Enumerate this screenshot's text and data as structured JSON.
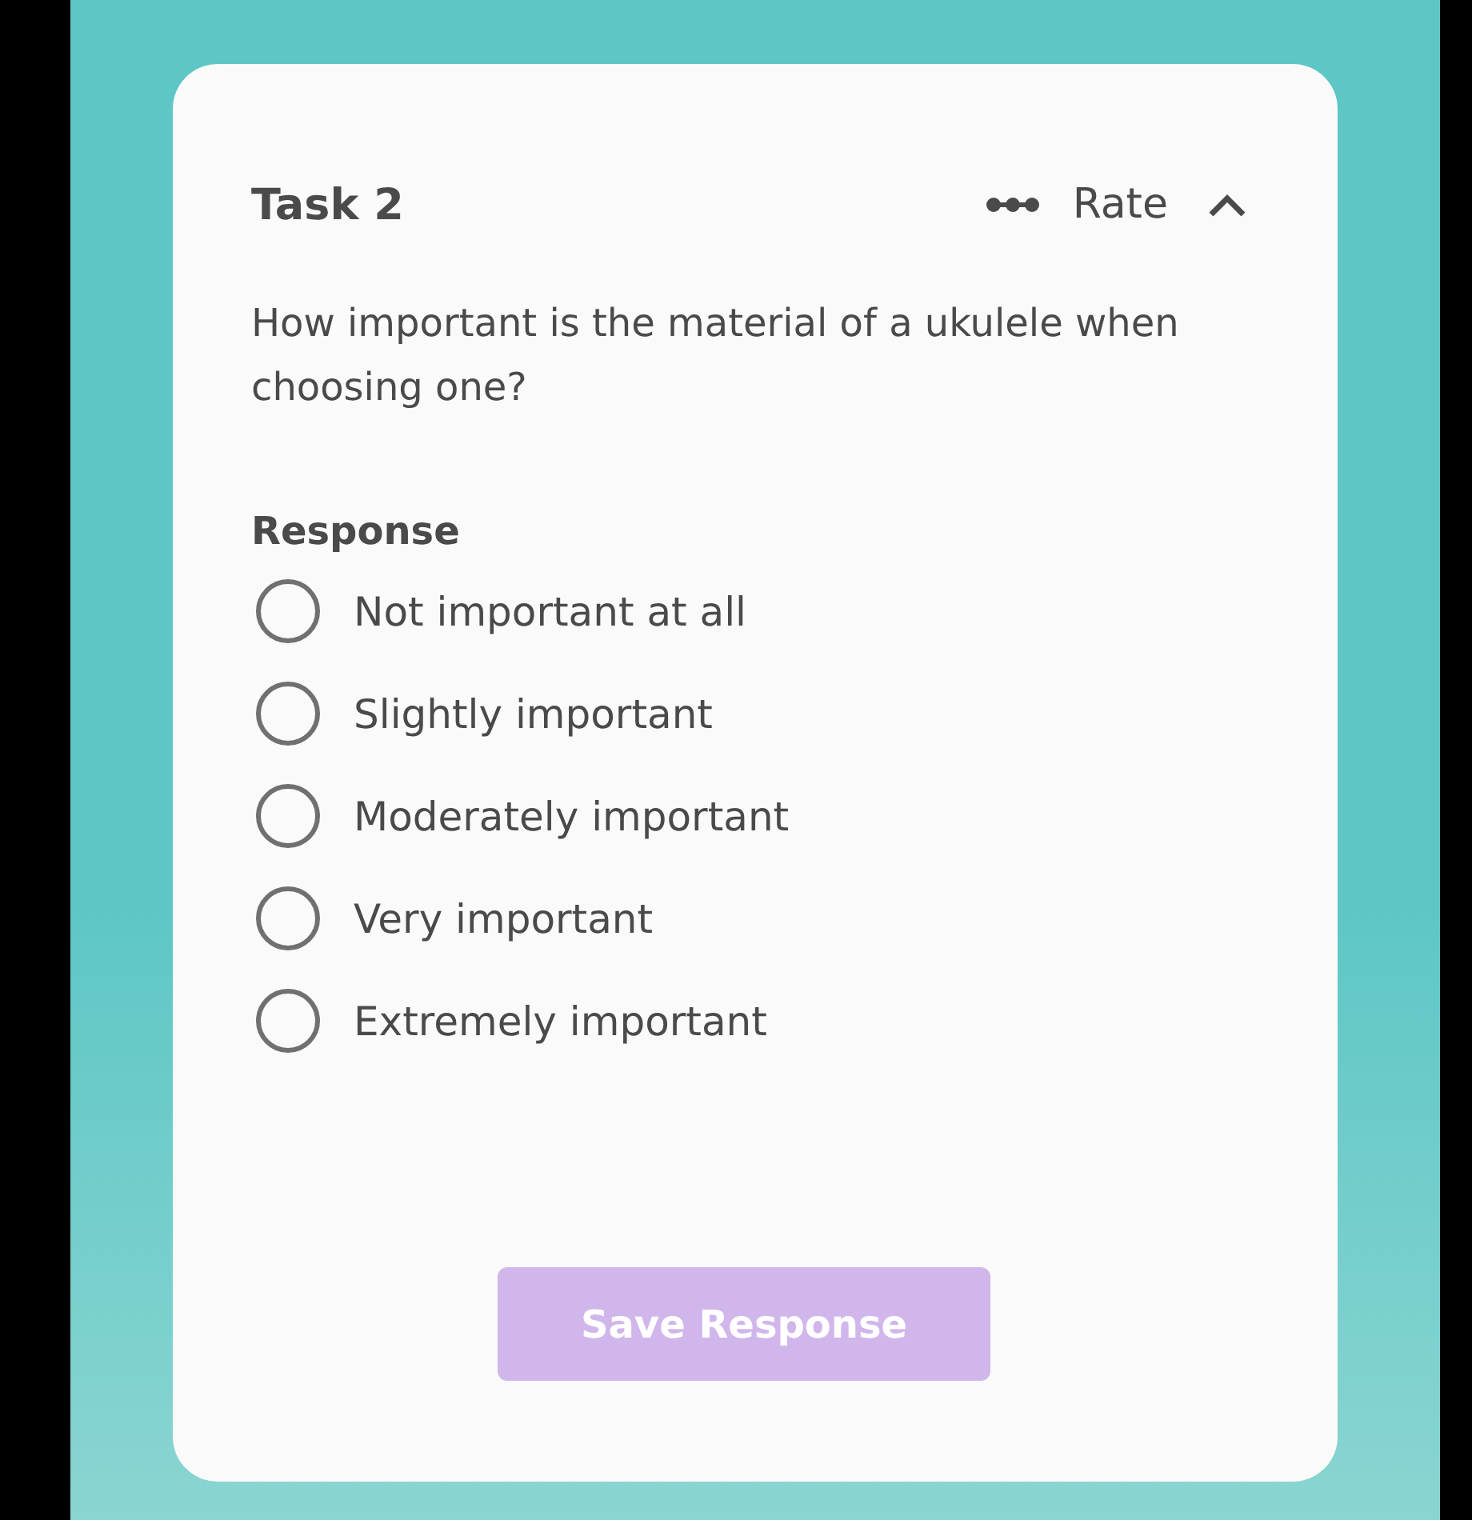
{
  "task": {
    "title": "Task 2",
    "type_label": "Rate",
    "expanded": true
  },
  "question": "How important is the material of a ukulele when choosing one?",
  "response": {
    "label": "Response",
    "options": [
      {
        "label": "Not important at all",
        "selected": false
      },
      {
        "label": "Slightly important",
        "selected": false
      },
      {
        "label": "Moderately important",
        "selected": false
      },
      {
        "label": "Very important",
        "selected": false
      },
      {
        "label": "Extremely important",
        "selected": false
      }
    ]
  },
  "save_button": {
    "label": "Save Response",
    "disabled": true
  }
}
